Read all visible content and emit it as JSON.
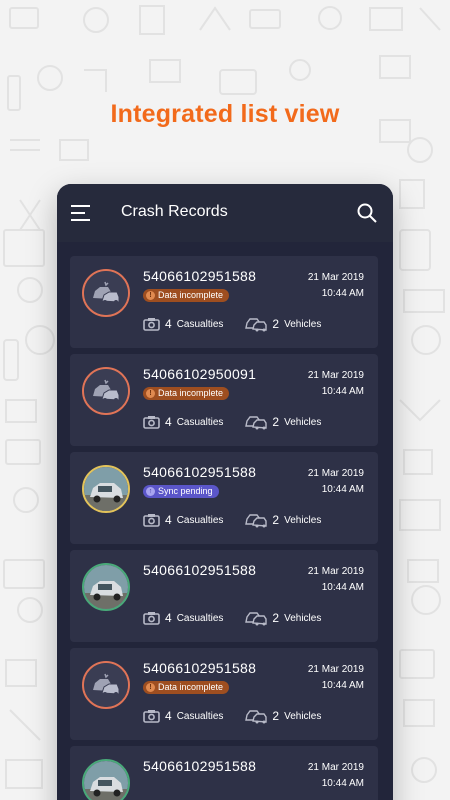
{
  "headline": "Integrated list view",
  "appbar": {
    "title": "Crash Records",
    "menu_icon": "menu-icon",
    "search_icon": "search-icon"
  },
  "colors": {
    "accent": "#f26a1b",
    "incomplete_badge": "#9e4e20",
    "sync_badge": "#5b56c9",
    "panel": "#22253a",
    "card": "#2e3147"
  },
  "records": [
    {
      "id": "54066102951588",
      "status": "Data incomplete",
      "status_type": "incomplete",
      "date": "21 Mar 2019",
      "time": "10:44 AM",
      "casualties_count": "4",
      "casualties_label": "Casualties",
      "vehicles_count": "2",
      "vehicles_label": "Vehicles",
      "avatar": "crash-placeholder-icon"
    },
    {
      "id": "54066102950091",
      "status": "Data incomplete",
      "status_type": "incomplete",
      "date": "21 Mar 2019",
      "time": "10:44 AM",
      "casualties_count": "4",
      "casualties_label": "Casualties",
      "vehicles_count": "2",
      "vehicles_label": "Vehicles",
      "avatar": "crash-placeholder-icon"
    },
    {
      "id": "54066102951588",
      "status": "Sync pending",
      "status_type": "sync",
      "date": "21 Mar 2019",
      "time": "10:44 AM",
      "casualties_count": "4",
      "casualties_label": "Casualties",
      "vehicles_count": "2",
      "vehicles_label": "Vehicles",
      "avatar": "crash-photo"
    },
    {
      "id": "54066102951588",
      "status": "",
      "status_type": "ok",
      "date": "21 Mar 2019",
      "time": "10:44 AM",
      "casualties_count": "4",
      "casualties_label": "Casualties",
      "vehicles_count": "2",
      "vehicles_label": "Vehicles",
      "avatar": "crash-photo"
    },
    {
      "id": "54066102951588",
      "status": "Data incomplete",
      "status_type": "incomplete",
      "date": "21 Mar 2019",
      "time": "10:44 AM",
      "casualties_count": "4",
      "casualties_label": "Casualties",
      "vehicles_count": "2",
      "vehicles_label": "Vehicles",
      "avatar": "crash-placeholder-icon"
    },
    {
      "id": "54066102951588",
      "status": "",
      "status_type": "ok",
      "date": "21 Mar 2019",
      "time": "10:44 AM",
      "casualties_count": "",
      "casualties_label": "",
      "vehicles_count": "",
      "vehicles_label": "",
      "avatar": "crash-photo"
    }
  ]
}
